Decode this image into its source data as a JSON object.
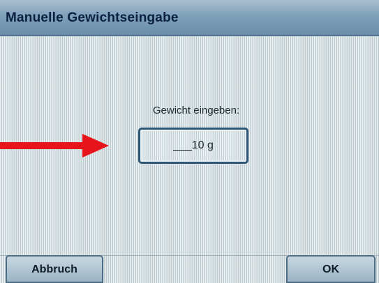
{
  "window": {
    "title": "Manuelle Gewichtseingabe"
  },
  "prompt": {
    "label": "Gewicht eingeben:"
  },
  "weight_field": {
    "value": "___10 g"
  },
  "buttons": {
    "cancel_label": "Abbruch",
    "ok_label": "OK"
  },
  "colors": {
    "titlebar": "#7fa0b9",
    "background": "#d4dfe2",
    "field_border": "#2d5576",
    "arrow": "#e8141c"
  }
}
